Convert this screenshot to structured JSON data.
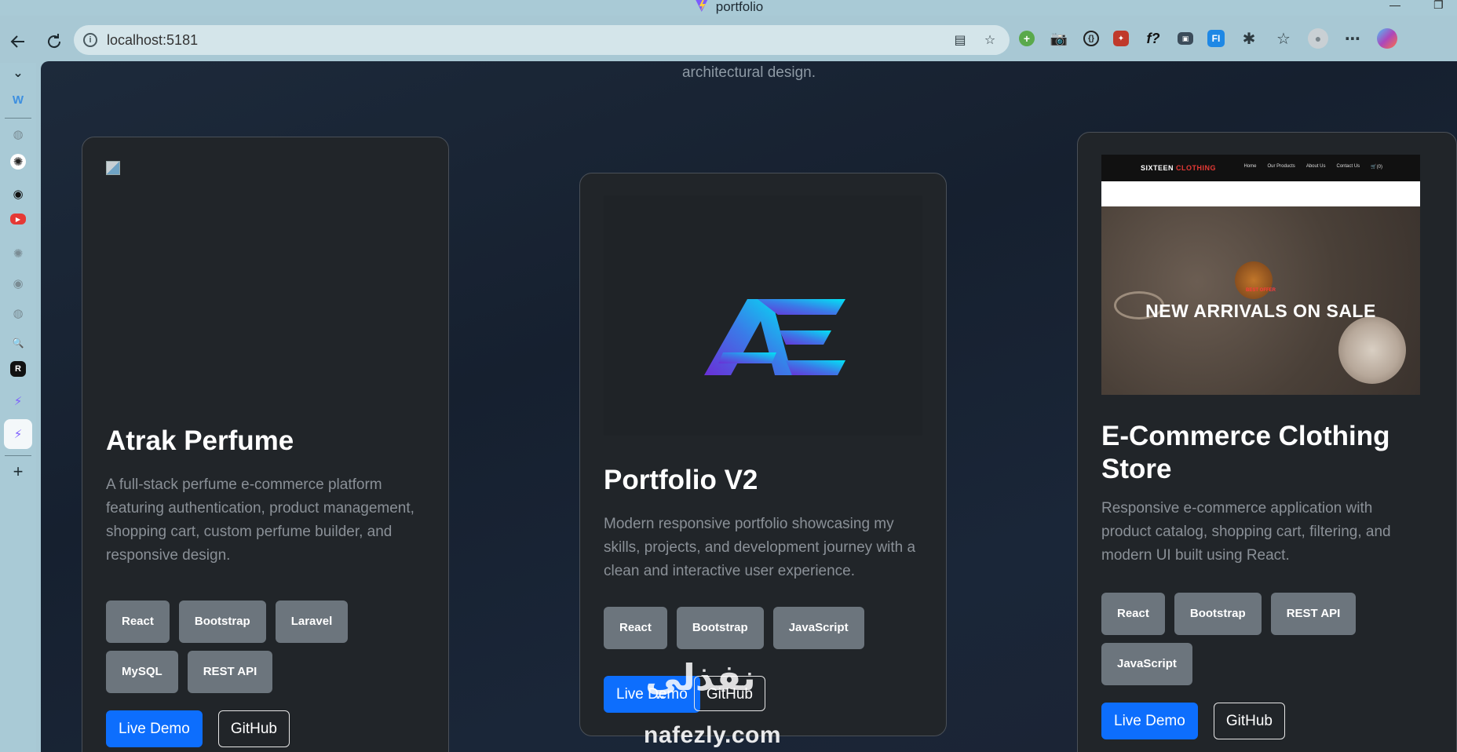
{
  "window": {
    "title": "portfolio"
  },
  "toolbar": {
    "url": "localhost:5181"
  },
  "page": {
    "intro_tail": "architectural design."
  },
  "projects": [
    {
      "title": "Atrak Perfume",
      "description": "A full-stack perfume e-commerce platform featuring authentication, product management, shopping cart, custom perfume builder, and responsive design.",
      "tags": [
        "React",
        "Bootstrap",
        "Laravel",
        "MySQL",
        "REST API"
      ],
      "live_label": "Live Demo",
      "github_label": "GitHub"
    },
    {
      "title": "Portfolio V2",
      "description": "Modern responsive portfolio showcasing my skills, projects, and development journey with a clean and interactive user experience.",
      "tags": [
        "React",
        "Bootstrap",
        "JavaScript"
      ],
      "live_label": "Live Demo",
      "github_label": "GitHub"
    },
    {
      "title": "E-Commerce Clothing Store",
      "description": "Responsive e-commerce application with product catalog, shopping cart, filtering, and modern UI built using React.",
      "tags": [
        "React",
        "Bootstrap",
        "REST API",
        "JavaScript"
      ],
      "live_label": "Live Demo",
      "github_label": "GitHub",
      "screenshot": {
        "brand_a": "SIXTEEN",
        "brand_b": "CLOTHING",
        "links": [
          "Home",
          "Our Products",
          "About Us",
          "Contact Us",
          "🛒(0)"
        ],
        "offer": "BEST OFFER",
        "headline": "NEW ARRIVALS ON SALE"
      }
    }
  ],
  "watermark": {
    "latin": "nafezly.com",
    "arabic": "نفذلي"
  },
  "colors": {
    "accent": "#0d6efd",
    "tag": "#6c757d",
    "card": "#212529"
  }
}
